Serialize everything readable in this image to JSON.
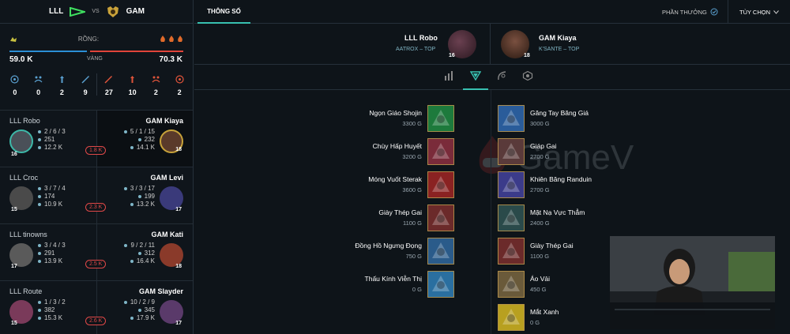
{
  "header": {
    "team_left": "LLL",
    "vs": "VS",
    "team_right": "GAM"
  },
  "summary": {
    "dragons_label": "RỒNG:",
    "gold_label": "VÀNG",
    "gold_left": "59.0 K",
    "gold_right": "70.3 K",
    "stats": [
      {
        "icon": "tower-icon",
        "value": "0"
      },
      {
        "icon": "inhibitor-icon",
        "value": "0"
      },
      {
        "icon": "baron-icon",
        "value": "2"
      },
      {
        "icon": "sword-icon",
        "value": "9"
      },
      {
        "icon": "sword-icon",
        "value": "27"
      },
      {
        "icon": "baron-icon",
        "value": "10"
      },
      {
        "icon": "inhibitor-icon",
        "value": "2"
      },
      {
        "icon": "tower-icon",
        "value": "2"
      }
    ]
  },
  "players": [
    {
      "left": {
        "name": "LLL Robo",
        "kda": "2 / 6 / 3",
        "cs": "251",
        "gold": "12.2 K",
        "level": "16"
      },
      "right": {
        "name": "GAM Kiaya",
        "kda": "5 / 1 / 15",
        "cs": "232",
        "gold": "14.1 K",
        "level": "18"
      },
      "diff": "1.8 K"
    },
    {
      "left": {
        "name": "LLL Croc",
        "kda": "3 / 7 / 4",
        "cs": "174",
        "gold": "10.9 K",
        "level": "15"
      },
      "right": {
        "name": "GAM Levi",
        "kda": "3 / 3 / 17",
        "cs": "199",
        "gold": "13.2 K",
        "level": "17"
      },
      "diff": "2.3 K"
    },
    {
      "left": {
        "name": "LLL tinowns",
        "kda": "3 / 4 / 3",
        "cs": "291",
        "gold": "13.9 K",
        "level": "17"
      },
      "right": {
        "name": "GAM Kati",
        "kda": "9 / 2 / 11",
        "cs": "312",
        "gold": "16.4 K",
        "level": "18"
      },
      "diff": "2.5 K"
    },
    {
      "left": {
        "name": "LLL Route",
        "kda": "1 / 3 / 2",
        "cs": "382",
        "gold": "15.3 K",
        "level": "15"
      },
      "right": {
        "name": "GAM Slayder",
        "kda": "10 / 2 / 9",
        "cs": "345",
        "gold": "17.9 K",
        "level": "17"
      },
      "diff": "2.6 K"
    }
  ],
  "tabs": {
    "main_tab": "THÔNG SỐ",
    "rewards": "PHẦN THƯỞNG",
    "options": "TÙY CHỌN"
  },
  "matchup": {
    "left": {
      "name": "LLL Robo",
      "sub": "AATROX – TOP",
      "level": "16"
    },
    "right": {
      "name": "GAM Kiaya",
      "sub": "K'SANTE – TOP",
      "level": "18"
    }
  },
  "items_left": [
    {
      "name": "Ngọn Giáo Shojin",
      "gold": "3300 G",
      "color": "#1d7a3c"
    },
    {
      "name": "Chùy Hấp Huyết",
      "gold": "3200 G",
      "color": "#7a2b3a"
    },
    {
      "name": "Móng Vuốt Sterak",
      "gold": "3600 G",
      "color": "#8a2222"
    },
    {
      "name": "Giày Thép Gai",
      "gold": "1100 G",
      "color": "#6b2a2a"
    },
    {
      "name": "Đồng Hồ Ngưng Đọng",
      "gold": "750 G",
      "color": "#2a5b8a"
    },
    {
      "name": "Thấu Kính Viễn Thị",
      "gold": "0 G",
      "color": "#2a6fa0"
    }
  ],
  "items_right": [
    {
      "name": "Găng Tay Băng Giá",
      "gold": "3000 G",
      "color": "#2a5c9a"
    },
    {
      "name": "Giáp Gai",
      "gold": "2700 G",
      "color": "#5a3a3a"
    },
    {
      "name": "Khiên Băng Randuin",
      "gold": "2700 G",
      "color": "#3b3b8a"
    },
    {
      "name": "Mặt Nạ Vực Thẳm",
      "gold": "2400 G",
      "color": "#2a4a4a"
    },
    {
      "name": "Giày Thép Gai",
      "gold": "1100 G",
      "color": "#6b2a2a"
    },
    {
      "name": "Áo Vải",
      "gold": "450 G",
      "color": "#6a5a3a"
    },
    {
      "name": "Mắt Xanh",
      "gold": "0 G",
      "color": "#b8a020"
    }
  ],
  "watermark": "GameV",
  "colors": {
    "accent": "#38c0b0",
    "blue_team": "#2b8fd6",
    "red_team": "#e0443a",
    "deficit": "#e04848"
  }
}
